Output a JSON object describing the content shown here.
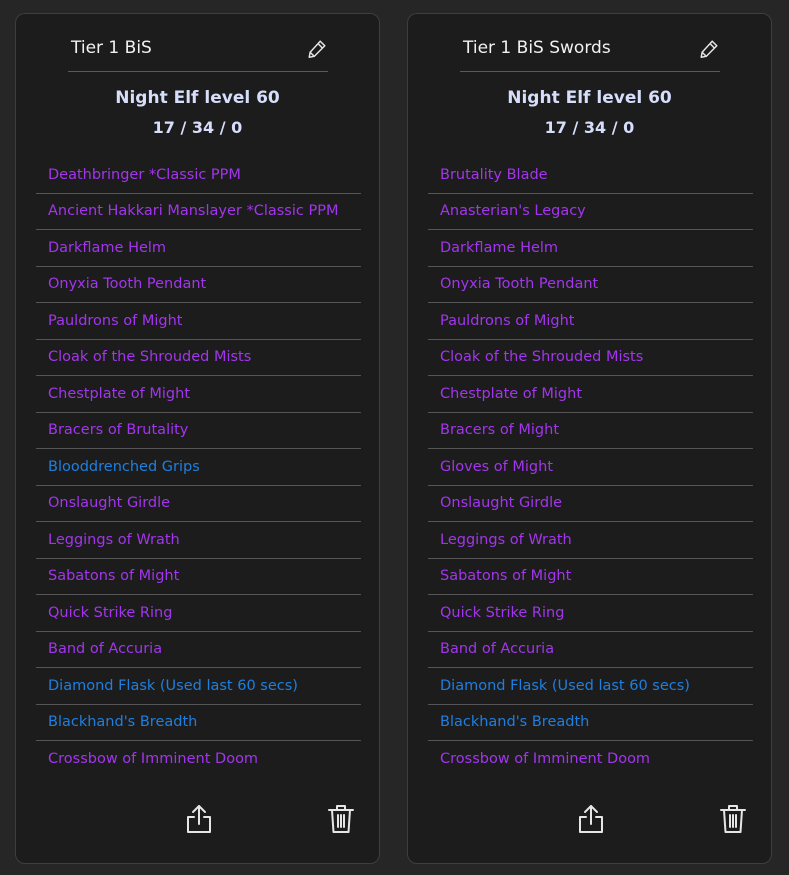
{
  "colors": {
    "epic": "#a335ee",
    "rare": "#1f7fe0",
    "title": "#f2f2f2",
    "character": "#d7defb"
  },
  "icons": {
    "edit": "pencil-icon",
    "share": "share-icon",
    "delete": "trash-icon"
  },
  "cards": [
    {
      "title": "Tier 1 BiS",
      "character": "Night Elf level 60",
      "talents": "17 / 34 / 0",
      "items": [
        {
          "name": "Deathbringer *Classic PPM",
          "quality": "epic"
        },
        {
          "name": "Ancient Hakkari Manslayer *Classic PPM",
          "quality": "epic"
        },
        {
          "name": "Darkflame Helm",
          "quality": "epic"
        },
        {
          "name": "Onyxia Tooth Pendant",
          "quality": "epic"
        },
        {
          "name": "Pauldrons of Might",
          "quality": "epic"
        },
        {
          "name": "Cloak of the Shrouded Mists",
          "quality": "epic"
        },
        {
          "name": "Chestplate of Might",
          "quality": "epic"
        },
        {
          "name": "Bracers of Brutality",
          "quality": "epic"
        },
        {
          "name": "Blooddrenched Grips",
          "quality": "rare"
        },
        {
          "name": "Onslaught Girdle",
          "quality": "epic"
        },
        {
          "name": "Leggings of Wrath",
          "quality": "epic"
        },
        {
          "name": "Sabatons of Might",
          "quality": "epic"
        },
        {
          "name": "Quick Strike Ring",
          "quality": "epic"
        },
        {
          "name": "Band of Accuria",
          "quality": "epic"
        },
        {
          "name": "Diamond Flask (Used last 60 secs)",
          "quality": "rare"
        },
        {
          "name": "Blackhand's Breadth",
          "quality": "rare"
        },
        {
          "name": "Crossbow of Imminent Doom",
          "quality": "epic"
        }
      ]
    },
    {
      "title": "Tier 1 BiS Swords",
      "character": "Night Elf level 60",
      "talents": "17 / 34 / 0",
      "items": [
        {
          "name": "Brutality Blade",
          "quality": "epic"
        },
        {
          "name": "Anasterian's Legacy",
          "quality": "epic"
        },
        {
          "name": "Darkflame Helm",
          "quality": "epic"
        },
        {
          "name": "Onyxia Tooth Pendant",
          "quality": "epic"
        },
        {
          "name": "Pauldrons of Might",
          "quality": "epic"
        },
        {
          "name": "Cloak of the Shrouded Mists",
          "quality": "epic"
        },
        {
          "name": "Chestplate of Might",
          "quality": "epic"
        },
        {
          "name": "Bracers of Might",
          "quality": "epic"
        },
        {
          "name": "Gloves of Might",
          "quality": "epic"
        },
        {
          "name": "Onslaught Girdle",
          "quality": "epic"
        },
        {
          "name": "Leggings of Wrath",
          "quality": "epic"
        },
        {
          "name": "Sabatons of Might",
          "quality": "epic"
        },
        {
          "name": "Quick Strike Ring",
          "quality": "epic"
        },
        {
          "name": "Band of Accuria",
          "quality": "epic"
        },
        {
          "name": "Diamond Flask (Used last 60 secs)",
          "quality": "rare"
        },
        {
          "name": "Blackhand's Breadth",
          "quality": "rare"
        },
        {
          "name": "Crossbow of Imminent Doom",
          "quality": "epic"
        }
      ]
    }
  ]
}
